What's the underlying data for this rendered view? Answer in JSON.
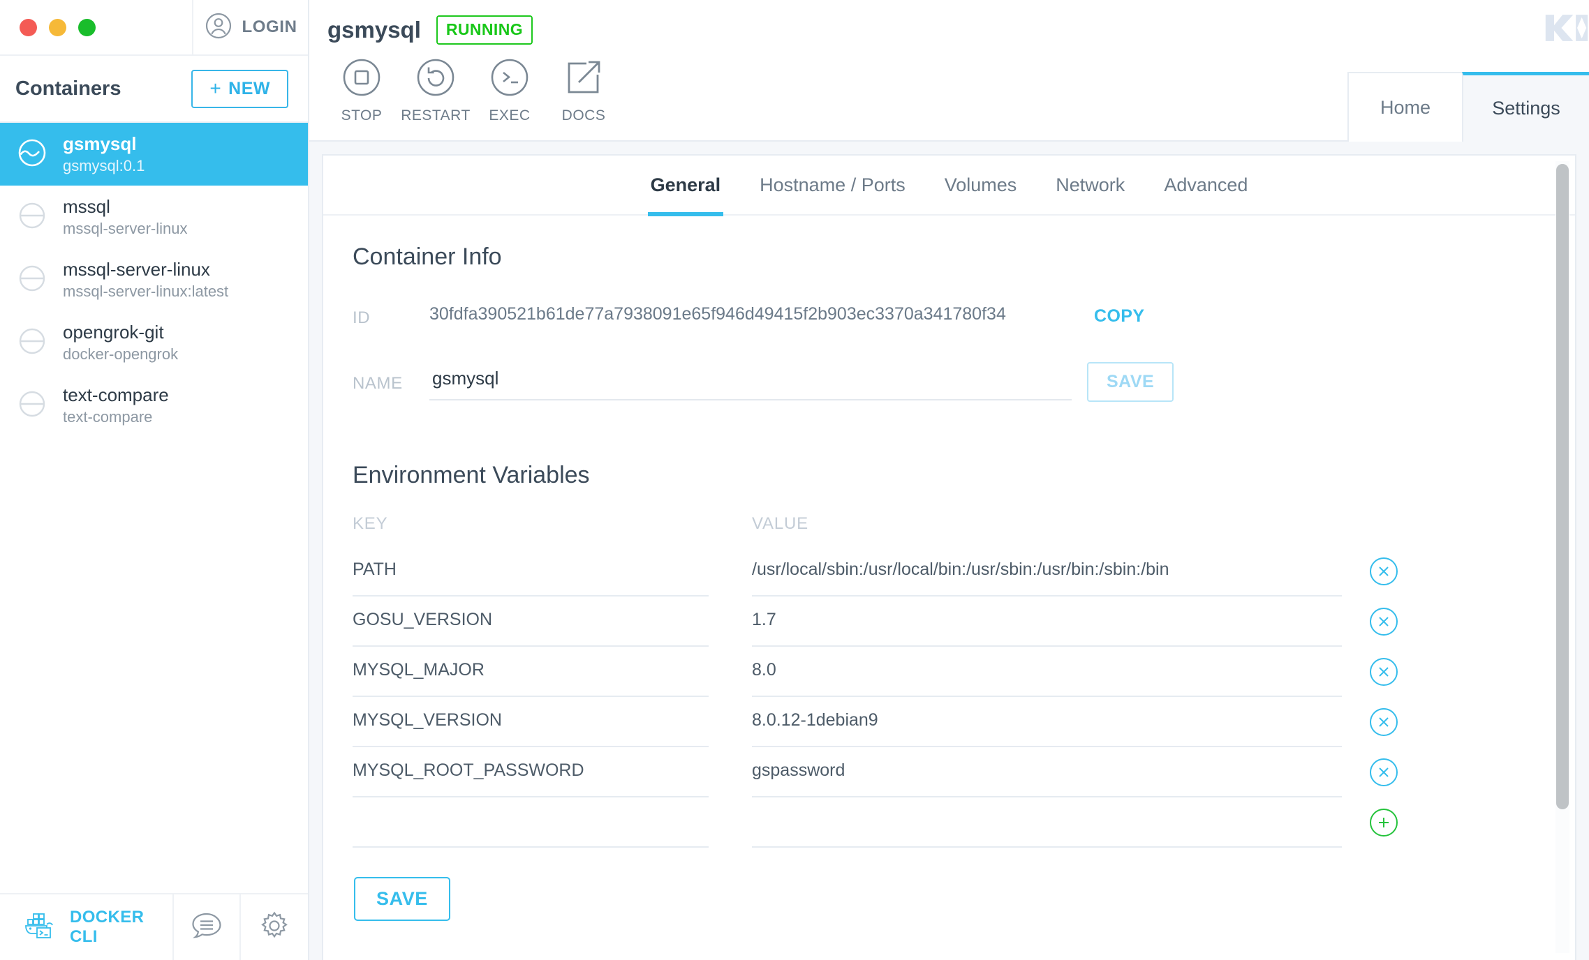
{
  "window": {
    "traffic_lights": [
      "close",
      "minimize",
      "zoom"
    ],
    "login_label": "LOGIN",
    "brand_logo": "KI"
  },
  "sidebar": {
    "heading": "Containers",
    "new_button": "NEW",
    "new_button_plus": "+",
    "containers": [
      {
        "name": "gsmysql",
        "image": "gsmysql:0.1",
        "selected": true
      },
      {
        "name": "mssql",
        "image": "mssql-server-linux",
        "selected": false
      },
      {
        "name": "mssql-server-linux",
        "image": "mssql-server-linux:latest",
        "selected": false
      },
      {
        "name": "opengrok-git",
        "image": "docker-opengrok",
        "selected": false
      },
      {
        "name": "text-compare",
        "image": "text-compare",
        "selected": false
      }
    ],
    "footer": {
      "cli_label": "DOCKER CLI",
      "cli_icon": "docker-whale-terminal-icon",
      "chat_icon": "chat-bubble-icon",
      "settings_icon": "gear-icon"
    }
  },
  "header": {
    "container_name": "gsmysql",
    "status": "RUNNING",
    "status_color": "#18c718",
    "actions": [
      {
        "label": "STOP",
        "icon": "stop-square-icon"
      },
      {
        "label": "RESTART",
        "icon": "restart-arrow-icon"
      },
      {
        "label": "EXEC",
        "icon": "terminal-prompt-icon"
      },
      {
        "label": "DOCS",
        "icon": "external-link-icon"
      }
    ],
    "tabs": [
      {
        "label": "Home",
        "active": false
      },
      {
        "label": "Settings",
        "active": true
      }
    ]
  },
  "settings": {
    "subtabs": [
      {
        "label": "General",
        "active": true
      },
      {
        "label": "Hostname / Ports",
        "active": false
      },
      {
        "label": "Volumes",
        "active": false
      },
      {
        "label": "Network",
        "active": false
      },
      {
        "label": "Advanced",
        "active": false
      }
    ],
    "container_info": {
      "title": "Container Info",
      "id_label": "ID",
      "id_value": "30fdfa390521b61de77a7938091e65f946d49415f2b903ec3370a341780f34",
      "copy_label": "COPY",
      "name_label": "NAME",
      "name_value": "gsmysql",
      "name_placeholder": "",
      "name_save_label": "SAVE"
    },
    "environment": {
      "title": "Environment Variables",
      "columns": [
        "KEY",
        "VALUE"
      ],
      "rows": [
        {
          "key": "PATH",
          "value": "/usr/local/sbin:/usr/local/bin:/usr/sbin:/usr/bin:/sbin:/bin"
        },
        {
          "key": "GOSU_VERSION",
          "value": "1.7"
        },
        {
          "key": "MYSQL_MAJOR",
          "value": "8.0"
        },
        {
          "key": "MYSQL_VERSION",
          "value": "8.0.12-1debian9"
        },
        {
          "key": "MYSQL_ROOT_PASSWORD",
          "value": "gspassword"
        },
        {
          "key": "",
          "value": ""
        }
      ],
      "remove_icon": "close-circle-icon",
      "add_icon": "plus-circle-icon",
      "save_label": "SAVE"
    }
  },
  "colors": {
    "accent": "#35bdec",
    "running_green": "#18c718",
    "add_green": "#25c33c",
    "page_bg": "#f5f7fa",
    "text_dark": "#3b4a59",
    "text_muted": "#8d98a3"
  }
}
